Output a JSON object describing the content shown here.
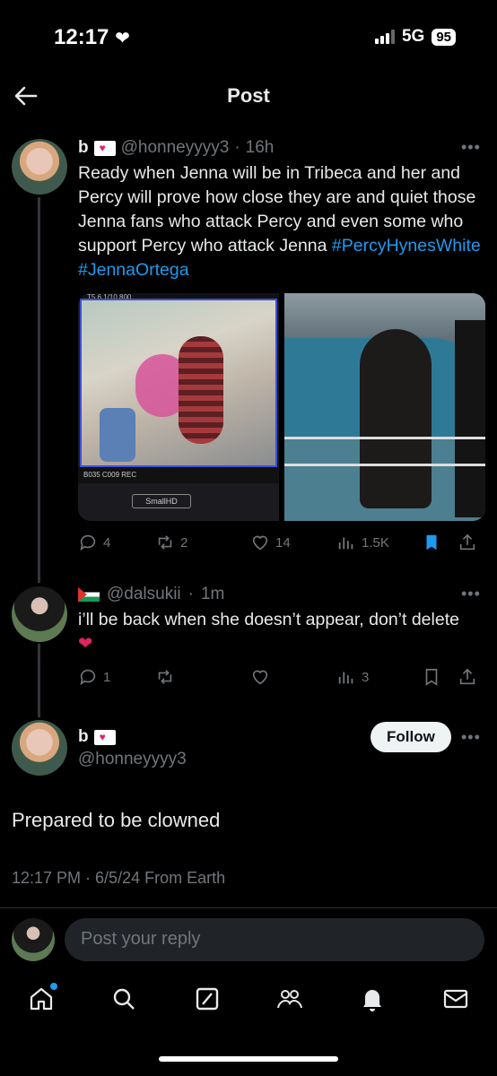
{
  "status_bar": {
    "time": "12:17",
    "network": "5G",
    "battery": "95"
  },
  "header": {
    "title": "Post"
  },
  "tweet1": {
    "name": "b",
    "handle": "@honneyyyy3",
    "sep": "·",
    "time": "16h",
    "text_part1": "Ready when Jenna will be in Tribeca and her and Percy will prove how close they are and quiet those Jenna fans who attack Percy and even some who support Percy who attack Jenna ",
    "hashtag1": "#PercyHynesWhite",
    "hashtag2": "#JennaOrtega",
    "monitor_top": "T5.6   1/10   800",
    "monitor_bottom": "B035  C009  REC",
    "monitor_brand": "SmallHD",
    "replies": "4",
    "reposts": "2",
    "likes": "14",
    "views": "1.5K"
  },
  "reply": {
    "handle": "@dalsukii",
    "sep": "·",
    "time": "1m",
    "text": "i’ll be back when she doesn’t appear, don’t delete",
    "replies": "1",
    "views": "3"
  },
  "main_post": {
    "name": "b",
    "handle": "@honneyyyy3",
    "follow_label": "Follow",
    "text": "Prepared to be clowned",
    "meta": "12:17 PM · 6/5/24 From Earth"
  },
  "reply_input": {
    "placeholder": "Post your reply"
  },
  "nav": [
    "home-icon",
    "search-icon",
    "grok-icon",
    "communities-icon",
    "notifications-icon",
    "messages-icon"
  ],
  "colors": {
    "accent": "#1d9bf0",
    "background": "#000000",
    "like_red": "#e0245e"
  }
}
